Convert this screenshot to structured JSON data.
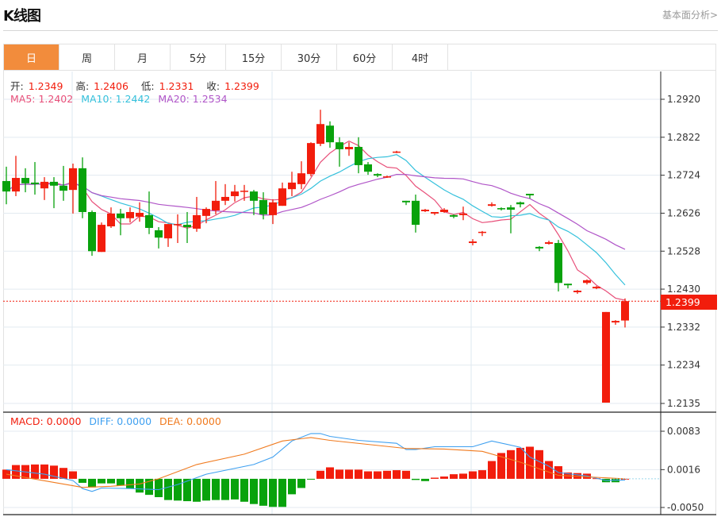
{
  "header": {
    "title": "K线图",
    "more_link": "基本面分析>"
  },
  "tabs": [
    {
      "label": "日",
      "active": true
    },
    {
      "label": "周"
    },
    {
      "label": "月"
    },
    {
      "label": "5分"
    },
    {
      "label": "15分"
    },
    {
      "label": "30分"
    },
    {
      "label": "60分"
    },
    {
      "label": "4时"
    }
  ],
  "ohlc_legend": {
    "open_label": "开:",
    "open": "1.2349",
    "high_label": "高:",
    "high": "1.2406",
    "low_label": "低:",
    "low": "1.2331",
    "close_label": "收:",
    "close": "1.2399"
  },
  "ma_legend": {
    "ma5": "MA5: 1.2402",
    "ma10": "MA10: 1.2442",
    "ma20": "MA20: 1.2534"
  },
  "macd_legend": {
    "macd": "MACD: 0.0000",
    "diff": "DIFF: 0.0000",
    "dea": "DEA: 0.0000"
  },
  "current_price": "1.2399",
  "colors": {
    "up": "#f21d0c",
    "down": "#08a20c",
    "ma5": "#e8507a",
    "ma10": "#35c1dc",
    "ma20": "#b055c8",
    "diff": "#3fa0f0",
    "dea": "#f07a1e",
    "accent": "#f28c3c"
  },
  "chart_data": [
    {
      "type": "candlestick",
      "title": "K线图",
      "y_ticks": [
        "1.2920",
        "1.2822",
        "1.2724",
        "1.2626",
        "1.2528",
        "1.2430",
        "1.2332",
        "1.2234",
        "1.2135"
      ],
      "ylim": [
        1.2135,
        1.292
      ],
      "current_price": 1.2399,
      "moving_averages": [
        5,
        10,
        20
      ],
      "ohlc": [
        [
          1.2709,
          1.2746,
          1.2649,
          1.2682
        ],
        [
          1.2682,
          1.2774,
          1.267,
          1.2717
        ],
        [
          1.2717,
          1.2742,
          1.268,
          1.2703
        ],
        [
          1.2705,
          1.2758,
          1.2674,
          1.2701
        ],
        [
          1.269,
          1.2719,
          1.266,
          1.2707
        ],
        [
          1.2707,
          1.2719,
          1.2639,
          1.2697
        ],
        [
          1.2697,
          1.2748,
          1.2658,
          1.2684
        ],
        [
          1.2686,
          1.2754,
          1.2625,
          1.2742
        ],
        [
          1.2742,
          1.277,
          1.2613,
          1.2629
        ],
        [
          1.2629,
          1.2633,
          1.2516,
          1.2528
        ],
        [
          1.2526,
          1.2602,
          1.2526,
          1.2596
        ],
        [
          1.2592,
          1.2641,
          1.2588,
          1.2625
        ],
        [
          1.2625,
          1.2637,
          1.2569,
          1.2613
        ],
        [
          1.2613,
          1.2641,
          1.2602,
          1.2629
        ],
        [
          1.2617,
          1.2654,
          1.2604,
          1.2627
        ],
        [
          1.2621,
          1.2682,
          1.2572,
          1.2588
        ],
        [
          1.2582,
          1.259,
          1.2535,
          1.2563
        ],
        [
          1.2561,
          1.2598,
          1.2539,
          1.2598
        ],
        [
          1.2596,
          1.2623,
          1.2549,
          1.2598
        ],
        [
          1.2596,
          1.2629,
          1.2549,
          1.259
        ],
        [
          1.2586,
          1.2668,
          1.2578,
          1.2621
        ],
        [
          1.2619,
          1.2641,
          1.26,
          1.2637
        ],
        [
          1.2633,
          1.2709,
          1.2623,
          1.2658
        ],
        [
          1.2658,
          1.2701,
          1.2647,
          1.2668
        ],
        [
          1.267,
          1.2699,
          1.2656,
          1.2682
        ],
        [
          1.2682,
          1.2699,
          1.2658,
          1.2684
        ],
        [
          1.2682,
          1.2686,
          1.2621,
          1.2658
        ],
        [
          1.266,
          1.268,
          1.261,
          1.2623
        ],
        [
          1.2621,
          1.2662,
          1.2598,
          1.2654
        ],
        [
          1.2645,
          1.2705,
          1.2645,
          1.269
        ],
        [
          1.2688,
          1.2733,
          1.267,
          1.2705
        ],
        [
          1.2701,
          1.276,
          1.2688,
          1.2729
        ],
        [
          1.2727,
          1.2809,
          1.2721,
          1.2807
        ],
        [
          1.2805,
          1.2893,
          1.2799,
          1.2856
        ],
        [
          1.2852,
          1.2863,
          1.2795,
          1.2809
        ],
        [
          1.2809,
          1.2822,
          1.2746,
          1.2791
        ],
        [
          1.2791,
          1.2809,
          1.2774,
          1.2797
        ],
        [
          1.2797,
          1.2822,
          1.2729,
          1.275
        ],
        [
          1.2752,
          1.2758,
          1.2725,
          1.2733
        ],
        [
          1.2727,
          1.2729,
          1.2719,
          1.2723
        ],
        [
          1.2719,
          1.2723,
          1.2717,
          1.2721
        ],
        [
          1.2783,
          1.2787,
          1.2781,
          1.2785
        ],
        [
          1.2658,
          1.2658,
          1.2647,
          1.2654
        ],
        [
          1.2658,
          1.2674,
          1.2576,
          1.2596
        ],
        [
          1.2631,
          1.2637,
          1.2629,
          1.2635
        ],
        [
          1.2625,
          1.2629,
          1.2621,
          1.2629
        ],
        [
          1.2629,
          1.2639,
          1.2627,
          1.2635
        ],
        [
          1.2621,
          1.2623,
          1.2613,
          1.2617
        ],
        [
          1.2621,
          1.2643,
          1.2608,
          1.2625
        ],
        [
          1.2549,
          1.2559,
          1.2543,
          1.2553
        ],
        [
          1.2576,
          1.258,
          1.2567,
          1.2578
        ],
        [
          1.2645,
          1.2654,
          1.2643,
          1.2649
        ],
        [
          1.2639,
          1.2641,
          1.2633,
          1.2637
        ],
        [
          1.2641,
          1.2647,
          1.2574,
          1.2635
        ],
        [
          1.2654,
          1.2656,
          1.2641,
          1.2649
        ],
        [
          1.2676,
          1.2676,
          1.2664,
          1.2672
        ],
        [
          1.2539,
          1.2541,
          1.2528,
          1.2535
        ],
        [
          1.2547,
          1.2555,
          1.2545,
          1.2551
        ],
        [
          1.2549,
          1.2557,
          1.2424,
          1.2446
        ],
        [
          1.2444,
          1.2444,
          1.2432,
          1.244
        ],
        [
          1.2422,
          1.2428,
          1.2418,
          1.2426
        ],
        [
          1.2446,
          1.2455,
          1.2442,
          1.2453
        ],
        [
          1.2432,
          1.2438,
          1.243,
          1.2436
        ],
        [
          1.2137,
          1.2371,
          1.2137,
          1.2371
        ],
        [
          1.2344,
          1.235,
          1.2338,
          1.2348
        ],
        [
          1.2349,
          1.2406,
          1.2331,
          1.2399
        ]
      ]
    },
    {
      "type": "bar",
      "title": "MACD",
      "y_ticks": [
        "0.0083",
        "0.0016",
        "-0.0050"
      ],
      "ylim": [
        -0.005,
        0.0083
      ],
      "histogram": [
        0.0016,
        0.0024,
        0.0024,
        0.0025,
        0.0025,
        0.0023,
        0.0019,
        0.0013,
        -0.0007,
        -0.0015,
        -0.0008,
        -0.0008,
        -0.0012,
        -0.0017,
        -0.0024,
        -0.0028,
        -0.0032,
        -0.0037,
        -0.0038,
        -0.0039,
        -0.004,
        -0.0038,
        -0.0037,
        -0.0037,
        -0.0036,
        -0.004,
        -0.0044,
        -0.0047,
        -0.0049,
        -0.0049,
        -0.0027,
        -0.0016,
        -0.0001,
        0.0014,
        0.002,
        0.0016,
        0.0016,
        0.0016,
        0.0013,
        0.0013,
        0.0014,
        0.0015,
        0.0014,
        -0.0002,
        -0.0004,
        0.0002,
        0.0004,
        0.0008,
        0.0009,
        0.0013,
        0.0015,
        0.0031,
        0.0045,
        0.005,
        0.0054,
        0.0056,
        0.005,
        0.0031,
        0.0022,
        0.0011,
        0.001,
        0.0009,
        0.0001,
        -0.0006,
        -0.0006,
        0.0
      ],
      "diff": [
        [
          0,
          0.0016
        ],
        [
          4,
          0.0008
        ],
        [
          7,
          -0.0003
        ],
        [
          8,
          -0.0017
        ],
        [
          9,
          -0.0022
        ],
        [
          10,
          -0.0016
        ],
        [
          13,
          -0.0017
        ],
        [
          16,
          -0.0019
        ],
        [
          18,
          -0.001
        ],
        [
          21,
          0.0008
        ],
        [
          26,
          0.0025
        ],
        [
          28,
          0.0038
        ],
        [
          30,
          0.0066
        ],
        [
          32,
          0.0079
        ],
        [
          33,
          0.0079
        ],
        [
          34,
          0.0074
        ],
        [
          37,
          0.0067
        ],
        [
          41,
          0.0062
        ],
        [
          42,
          0.0051
        ],
        [
          43,
          0.0051
        ],
        [
          45,
          0.0056
        ],
        [
          49,
          0.0056
        ],
        [
          51,
          0.0066
        ],
        [
          54,
          0.0055
        ],
        [
          55,
          0.0038
        ],
        [
          57,
          0.0022
        ],
        [
          58,
          0.0011
        ],
        [
          61,
          0.0005
        ],
        [
          63,
          -0.0003
        ],
        [
          65,
          -0.0002
        ]
      ],
      "dea": [
        [
          0,
          0.0008
        ],
        [
          8,
          -0.0015
        ],
        [
          11,
          -0.0013
        ],
        [
          14,
          -0.0009
        ],
        [
          16,
          0.0
        ],
        [
          20,
          0.0025
        ],
        [
          25,
          0.0043
        ],
        [
          29,
          0.0066
        ],
        [
          32,
          0.0072
        ],
        [
          34,
          0.0067
        ],
        [
          42,
          0.0053
        ],
        [
          46,
          0.0052
        ],
        [
          50,
          0.0048
        ],
        [
          54,
          0.0029
        ],
        [
          58,
          0.0006
        ],
        [
          65,
          0.0
        ]
      ]
    }
  ]
}
